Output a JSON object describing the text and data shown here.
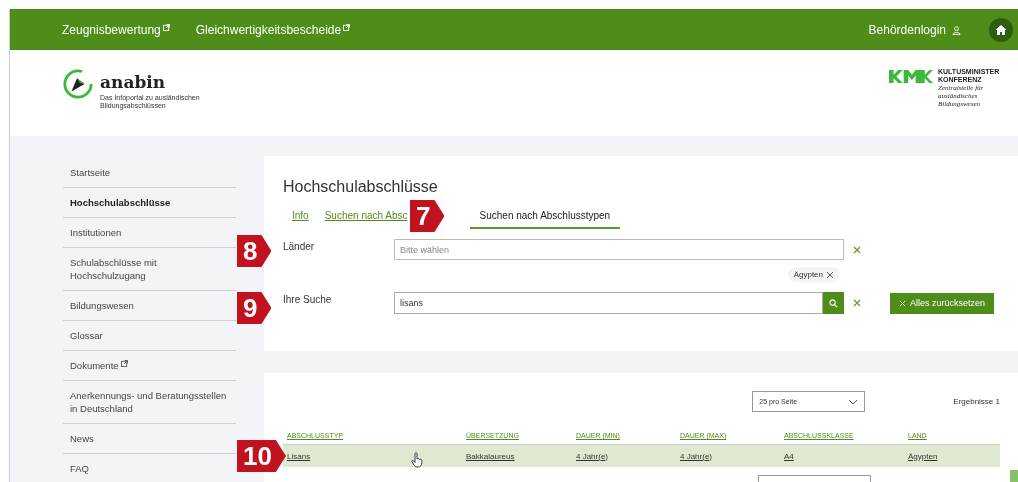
{
  "top_bar": {
    "links": [
      {
        "label": "Zeugnisbewertung",
        "external": true
      },
      {
        "label": "Gleichwertigkeitsbescheide",
        "external": true
      }
    ],
    "login": "Behördenlogin"
  },
  "header": {
    "logo_name": "anabin",
    "logo_tagline": "Das Infoportal zu ausländischen Bildungsabschlüssen",
    "partner_title": "KULTUSMINISTER KONFERENZ",
    "partner_subtitle": "Zentralstelle für ausländisches Bildungswesen"
  },
  "sidebar": {
    "items": [
      {
        "label": "Startseite",
        "selected": false,
        "external": false
      },
      {
        "label": "Hochschulabschlüsse",
        "selected": true,
        "external": false
      },
      {
        "label": "Institutionen",
        "selected": false,
        "external": false
      },
      {
        "label": "Schulabschlüsse mit Hochschulzugang",
        "selected": false,
        "external": false
      },
      {
        "label": "Bildungswesen",
        "selected": false,
        "external": false
      },
      {
        "label": "Glossar",
        "selected": false,
        "external": false
      },
      {
        "label": "Dokumente",
        "selected": false,
        "external": true
      },
      {
        "label": "Anerkennungs- und Beratungsstellen in Deutschland",
        "selected": false,
        "external": false
      },
      {
        "label": "News",
        "selected": false,
        "external": false
      },
      {
        "label": "FAQ",
        "selected": false,
        "external": false
      }
    ]
  },
  "search_panel": {
    "title": "Hochschulabschlüsse",
    "tabs": [
      {
        "label": "Info",
        "selected": false
      },
      {
        "label": "Suchen nach Absc",
        "selected": false
      },
      {
        "label": "Suchen nach Abschlusstypen",
        "selected": true
      }
    ],
    "countries": {
      "label": "Länder",
      "placeholder": "Bitte wählen",
      "chips": [
        "Ägypten"
      ]
    },
    "query": {
      "label": "Ihre Suche",
      "value": "lisans"
    },
    "reset_button": "Alles zurücksetzen"
  },
  "results": {
    "page_size": "25 pro Seite",
    "count": "Ergebnisse 1",
    "columns": [
      "ABSCHLUSSTYP",
      "ÜBERSETZUNG",
      "DAUER (MIN)",
      "DAUER (MAX)",
      "ABSCHLUSSKLASSE",
      "LAND"
    ],
    "rows": [
      {
        "cells": [
          "Lisans",
          "Bakkalaureus",
          "4 Jahr(e)",
          "4 Jahr(e)",
          "A4",
          "Ägypten"
        ],
        "selected": true
      }
    ]
  },
  "annotations": [
    {
      "label": "7"
    },
    {
      "label": "8"
    },
    {
      "label": "9"
    },
    {
      "label": "10"
    }
  ]
}
